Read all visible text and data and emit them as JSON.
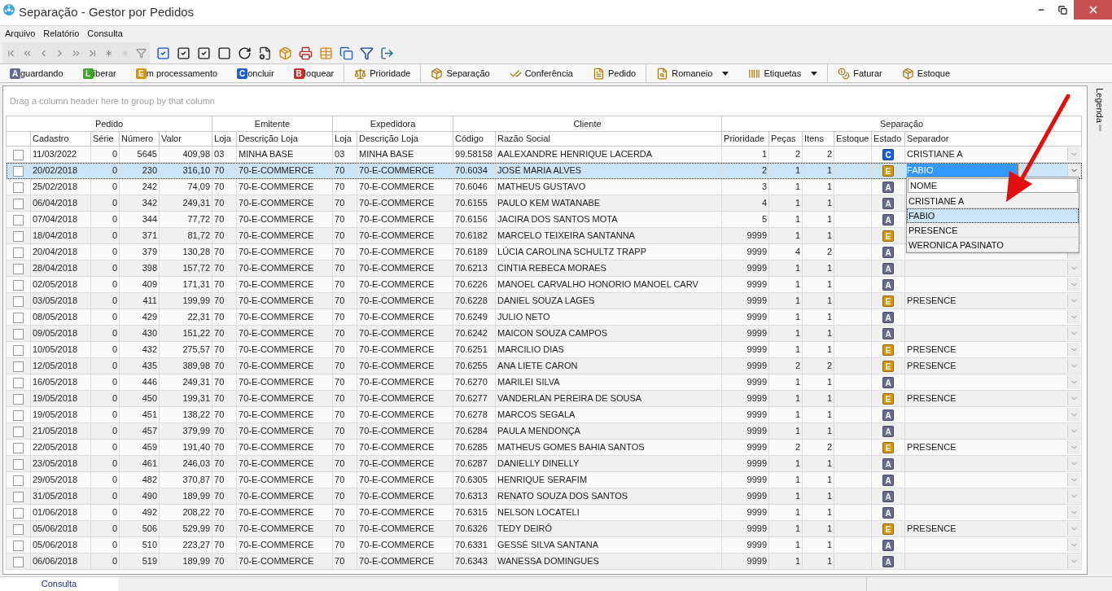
{
  "window": {
    "title": "Separação - Gestor por Pedidos"
  },
  "menu": [
    "Arquivo",
    "Relatório",
    "Consulta"
  ],
  "action_groups": [
    [
      {
        "badge": "A",
        "label": "guardando",
        "color": "#676b8a"
      },
      {
        "badge": "L",
        "label": "iberar",
        "color": "#3aa526"
      },
      {
        "badge": "E",
        "label": "m processamento",
        "color": "#d4960e"
      },
      {
        "badge": "C",
        "label": "oncluir",
        "color": "#1b5fd6"
      },
      {
        "badge": "B",
        "label": "loquear",
        "color": "#d12a2a"
      }
    ],
    [
      {
        "label": "Prioridade"
      }
    ],
    [
      {
        "label": "Separação"
      },
      {
        "label": "Conferência"
      },
      {
        "label": "Pedido"
      }
    ],
    [
      {
        "label": "Romaneio",
        "has_menu": true
      },
      {
        "label": "Etiquetas",
        "has_menu": true
      }
    ],
    [
      {
        "label": "Faturar"
      },
      {
        "label": "Estoque"
      }
    ]
  ],
  "group_panel": {
    "placeholder": "Drag a column header here to group by that column"
  },
  "column_groups": [
    "Pedido",
    "Emitente",
    "Expedidora",
    "Cliente",
    "Separação"
  ],
  "columns": [
    "Cadastro",
    "Série",
    "Número",
    "Valor",
    "Loja",
    "Descrição Loja",
    "Loja",
    "Descrição Loja",
    "Código",
    "Razão Social",
    "Prioridade",
    "Peças",
    "Itens",
    "Estoque",
    "Estado",
    "Separador"
  ],
  "rows": [
    {
      "selected": false,
      "checked": false,
      "cells": [
        "11/03/2022",
        "0",
        "5645",
        "409,98",
        "03",
        "MINHA BASE",
        "03",
        "MINHA BASE",
        "99.58158",
        "AALEXANDRE  HENRIQUE  LACERDA",
        "1",
        "2",
        "2"
      ],
      "estado": {
        "letter": "C",
        "color": "#1b5fd6"
      },
      "separador": "CRISTIANE A"
    },
    {
      "selected": true,
      "checked": false,
      "cells": [
        "20/02/2018",
        "0",
        "230",
        "316,10",
        "70",
        "70-E-COMMERCE",
        "70",
        "70-E-COMMERCE",
        "70.6034",
        "JOSÉ MARIA ALVES",
        "2",
        "1",
        "1"
      ],
      "estado": {
        "letter": "E",
        "color": "#d4960e"
      },
      "separador": "FABIO"
    },
    {
      "selected": false,
      "checked": false,
      "cells": [
        "25/02/2018",
        "0",
        "242",
        "74,09",
        "70",
        "70-E-COMMERCE",
        "70",
        "70-E-COMMERCE",
        "70.6046",
        "MATHEUS GUSTAVO",
        "3",
        "1",
        "1"
      ],
      "estado": {
        "letter": "A",
        "color": "#676b8a"
      }
    },
    {
      "selected": false,
      "checked": false,
      "cells": [
        "06/04/2018",
        "0",
        "342",
        "249,31",
        "70",
        "70-E-COMMERCE",
        "70",
        "70-E-COMMERCE",
        "70.6155",
        "PAULO KEM WATANABE",
        "4",
        "1",
        "1"
      ],
      "estado": {
        "letter": "A",
        "color": "#676b8a"
      }
    },
    {
      "selected": false,
      "checked": false,
      "cells": [
        "07/04/2018",
        "0",
        "344",
        "77,72",
        "70",
        "70-E-COMMERCE",
        "70",
        "70-E-COMMERCE",
        "70.6156",
        "JACIRA DOS SANTOS MOTA",
        "5",
        "1",
        "1"
      ],
      "estado": {
        "letter": "A",
        "color": "#676b8a"
      }
    },
    {
      "selected": false,
      "checked": false,
      "cells": [
        "18/04/2018",
        "0",
        "371",
        "81,72",
        "70",
        "70-E-COMMERCE",
        "70",
        "70-E-COMMERCE",
        "70.6182",
        "MARCELO TEIXEIRA SANTANNA",
        "9999",
        "1",
        "1"
      ],
      "estado": {
        "letter": "E",
        "color": "#d4960e"
      }
    },
    {
      "selected": false,
      "checked": false,
      "cells": [
        "20/04/2018",
        "0",
        "379",
        "130,28",
        "70",
        "70-E-COMMERCE",
        "70",
        "70-E-COMMERCE",
        "70.6189",
        "LÚCIA CAROLINA SCHULTZ TRAPP",
        "9999",
        "4",
        "2"
      ],
      "estado": {
        "letter": "A",
        "color": "#676b8a"
      }
    },
    {
      "selected": false,
      "checked": false,
      "cells": [
        "28/04/2018",
        "0",
        "398",
        "157,72",
        "70",
        "70-E-COMMERCE",
        "70",
        "70-E-COMMERCE",
        "70.6213",
        "CINTIA REBECA MORAES",
        "9999",
        "1",
        "1"
      ],
      "estado": {
        "letter": "A",
        "color": "#676b8a"
      }
    },
    {
      "selected": false,
      "checked": false,
      "cells": [
        "02/05/2018",
        "0",
        "409",
        "171,31",
        "70",
        "70-E-COMMERCE",
        "70",
        "70-E-COMMERCE",
        "70.6226",
        "MANOEL CARVALHO HONORIO MANOEL CARV",
        "9999",
        "1",
        "1"
      ],
      "estado": {
        "letter": "A",
        "color": "#676b8a"
      }
    },
    {
      "selected": false,
      "checked": false,
      "cells": [
        "03/05/2018",
        "0",
        "411",
        "199,99",
        "70",
        "70-E-COMMERCE",
        "70",
        "70-E-COMMERCE",
        "70.6228",
        "DANIEL SOUZA LAGES",
        "9999",
        "1",
        "1"
      ],
      "estado": {
        "letter": "E",
        "color": "#d4960e"
      },
      "separador": "PRESENCE"
    },
    {
      "selected": false,
      "checked": false,
      "cells": [
        "08/05/2018",
        "0",
        "429",
        "22,31",
        "70",
        "70-E-COMMERCE",
        "70",
        "70-E-COMMERCE",
        "70.6249",
        "JULIO NETO",
        "9999",
        "1",
        "1"
      ],
      "estado": {
        "letter": "A",
        "color": "#676b8a"
      }
    },
    {
      "selected": false,
      "checked": false,
      "cells": [
        "09/05/2018",
        "0",
        "430",
        "151,22",
        "70",
        "70-E-COMMERCE",
        "70",
        "70-E-COMMERCE",
        "70.6242",
        "MAICON SOUZA CAMPOS",
        "9999",
        "1",
        "1"
      ],
      "estado": {
        "letter": "A",
        "color": "#676b8a"
      }
    },
    {
      "selected": false,
      "checked": false,
      "cells": [
        "10/05/2018",
        "0",
        "432",
        "275,57",
        "70",
        "70-E-COMMERCE",
        "70",
        "70-E-COMMERCE",
        "70.6251",
        "MARCILIO DIAS",
        "9999",
        "1",
        "1"
      ],
      "estado": {
        "letter": "E",
        "color": "#d4960e"
      },
      "separador": "PRESENCE"
    },
    {
      "selected": false,
      "checked": false,
      "cells": [
        "12/05/2018",
        "0",
        "435",
        "389,98",
        "70",
        "70-E-COMMERCE",
        "70",
        "70-E-COMMERCE",
        "70.6255",
        "ANA LIETE CARON",
        "9999",
        "2",
        "2"
      ],
      "estado": {
        "letter": "E",
        "color": "#d4960e"
      },
      "separador": "PRESENCE"
    },
    {
      "selected": false,
      "checked": false,
      "cells": [
        "16/05/2018",
        "0",
        "446",
        "249,31",
        "70",
        "70-E-COMMERCE",
        "70",
        "70-E-COMMERCE",
        "70.6270",
        "MARILEI SILVA",
        "9999",
        "1",
        "1"
      ],
      "estado": {
        "letter": "A",
        "color": "#676b8a"
      }
    },
    {
      "selected": false,
      "checked": false,
      "cells": [
        "19/05/2018",
        "0",
        "450",
        "199,31",
        "70",
        "70-E-COMMERCE",
        "70",
        "70-E-COMMERCE",
        "70.6277",
        "VANDERLAN PEREIRA DE SOUSA",
        "9999",
        "1",
        "1"
      ],
      "estado": {
        "letter": "E",
        "color": "#d4960e"
      },
      "separador": "PRESENCE"
    },
    {
      "selected": false,
      "checked": false,
      "cells": [
        "19/05/2018",
        "0",
        "451",
        "138,22",
        "70",
        "70-E-COMMERCE",
        "70",
        "70-E-COMMERCE",
        "70.6278",
        "MARCOS SEGALA",
        "9999",
        "1",
        "1"
      ],
      "estado": {
        "letter": "A",
        "color": "#676b8a"
      }
    },
    {
      "selected": false,
      "checked": false,
      "cells": [
        "21/05/2018",
        "0",
        "457",
        "379,99",
        "70",
        "70-E-COMMERCE",
        "70",
        "70-E-COMMERCE",
        "70.6284",
        "PAULA MENDONÇA",
        "9999",
        "1",
        "1"
      ],
      "estado": {
        "letter": "A",
        "color": "#676b8a"
      }
    },
    {
      "selected": false,
      "checked": false,
      "cells": [
        "22/05/2018",
        "0",
        "459",
        "191,40",
        "70",
        "70-E-COMMERCE",
        "70",
        "70-E-COMMERCE",
        "70.6285",
        "MATHEUS GOMES BAHIA SANTOS",
        "9999",
        "2",
        "2"
      ],
      "estado": {
        "letter": "E",
        "color": "#d4960e"
      },
      "separador": "PRESENCE"
    },
    {
      "selected": false,
      "checked": false,
      "cells": [
        "23/05/2018",
        "0",
        "461",
        "246,03",
        "70",
        "70-E-COMMERCE",
        "70",
        "70-E-COMMERCE",
        "70.6287",
        "DANIELLY DINELLY",
        "9999",
        "1",
        "1"
      ],
      "estado": {
        "letter": "A",
        "color": "#676b8a"
      }
    },
    {
      "selected": false,
      "checked": false,
      "cells": [
        "29/05/2018",
        "0",
        "482",
        "370,87",
        "70",
        "70-E-COMMERCE",
        "70",
        "70-E-COMMERCE",
        "70.6305",
        "HENRIQUE SERAFIM",
        "9999",
        "1",
        "1"
      ],
      "estado": {
        "letter": "A",
        "color": "#676b8a"
      }
    },
    {
      "selected": false,
      "checked": false,
      "cells": [
        "31/05/2018",
        "0",
        "490",
        "189,99",
        "70",
        "70-E-COMMERCE",
        "70",
        "70-E-COMMERCE",
        "70.6313",
        "RENATO SOUZA DOS SANTOS",
        "9999",
        "1",
        "1"
      ],
      "estado": {
        "letter": "A",
        "color": "#676b8a"
      }
    },
    {
      "selected": false,
      "checked": false,
      "cells": [
        "01/06/2018",
        "0",
        "492",
        "208,22",
        "70",
        "70-E-COMMERCE",
        "70",
        "70-E-COMMERCE",
        "70.6315",
        "NELSON LOCATELI",
        "9999",
        "1",
        "1"
      ],
      "estado": {
        "letter": "A",
        "color": "#676b8a"
      }
    },
    {
      "selected": false,
      "checked": false,
      "cells": [
        "05/06/2018",
        "0",
        "506",
        "529,99",
        "70",
        "70-E-COMMERCE",
        "70",
        "70-E-COMMERCE",
        "70.6326",
        "TEDY DEIRÓ",
        "9999",
        "1",
        "1"
      ],
      "estado": {
        "letter": "E",
        "color": "#d4960e"
      },
      "separador": "PRESENCE"
    },
    {
      "selected": false,
      "checked": false,
      "cells": [
        "05/06/2018",
        "0",
        "510",
        "223,27",
        "70",
        "70-E-COMMERCE",
        "70",
        "70-E-COMMERCE",
        "70.6331",
        "GESSÉ SILVA SANTANA",
        "9999",
        "1",
        "1"
      ],
      "estado": {
        "letter": "A",
        "color": "#676b8a"
      }
    },
    {
      "selected": false,
      "checked": false,
      "cells": [
        "06/06/2018",
        "0",
        "519",
        "189,99",
        "70",
        "70-E-COMMERCE",
        "70",
        "70-E-COMMERCE",
        "70.6343",
        "WANESSA DOMINGUES",
        "9999",
        "1",
        "1"
      ],
      "estado": {
        "letter": "A",
        "color": "#676b8a"
      }
    }
  ],
  "separador_dropdown": {
    "header": "NOME",
    "options": [
      {
        "label": "CRISTIANE A",
        "selected": false
      },
      {
        "label": "FABIO",
        "selected": true
      },
      {
        "label": "PRESENCE",
        "selected": false
      },
      {
        "label": "WERONICA PASINATO",
        "selected": false
      }
    ]
  },
  "side_panel": {
    "label": "Legenda"
  },
  "bottom_tabs": [
    {
      "label": "Consulta",
      "selected": true
    }
  ]
}
